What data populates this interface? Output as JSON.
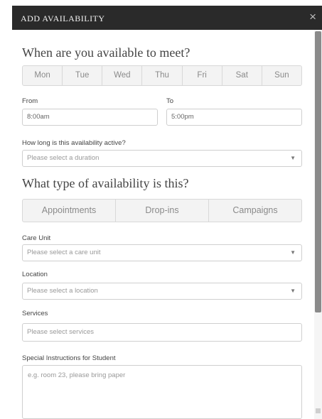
{
  "modal": {
    "title": "ADD AVAILABILITY",
    "close_icon": "×"
  },
  "availability": {
    "heading": "When are you available to meet?",
    "days": [
      "Mon",
      "Tue",
      "Wed",
      "Thu",
      "Fri",
      "Sat",
      "Sun"
    ]
  },
  "time": {
    "from_label": "From",
    "from_value": "8:00am",
    "to_label": "To",
    "to_value": "5:00pm"
  },
  "duration": {
    "label": "How long is this availability active?",
    "placeholder": "Please select a duration"
  },
  "type": {
    "heading": "What type of availability is this?",
    "options": [
      "Appointments",
      "Drop-ins",
      "Campaigns"
    ]
  },
  "care_unit": {
    "label": "Care Unit",
    "placeholder": "Please select a care unit"
  },
  "location": {
    "label": "Location",
    "placeholder": "Please select a location"
  },
  "services": {
    "label": "Services",
    "placeholder": "Please select services"
  },
  "instructions": {
    "label": "Special Instructions for Student",
    "placeholder": "e.g. room 23, please bring paper"
  },
  "icons": {
    "close": "close-icon",
    "dropdown": "caret-down-icon"
  }
}
